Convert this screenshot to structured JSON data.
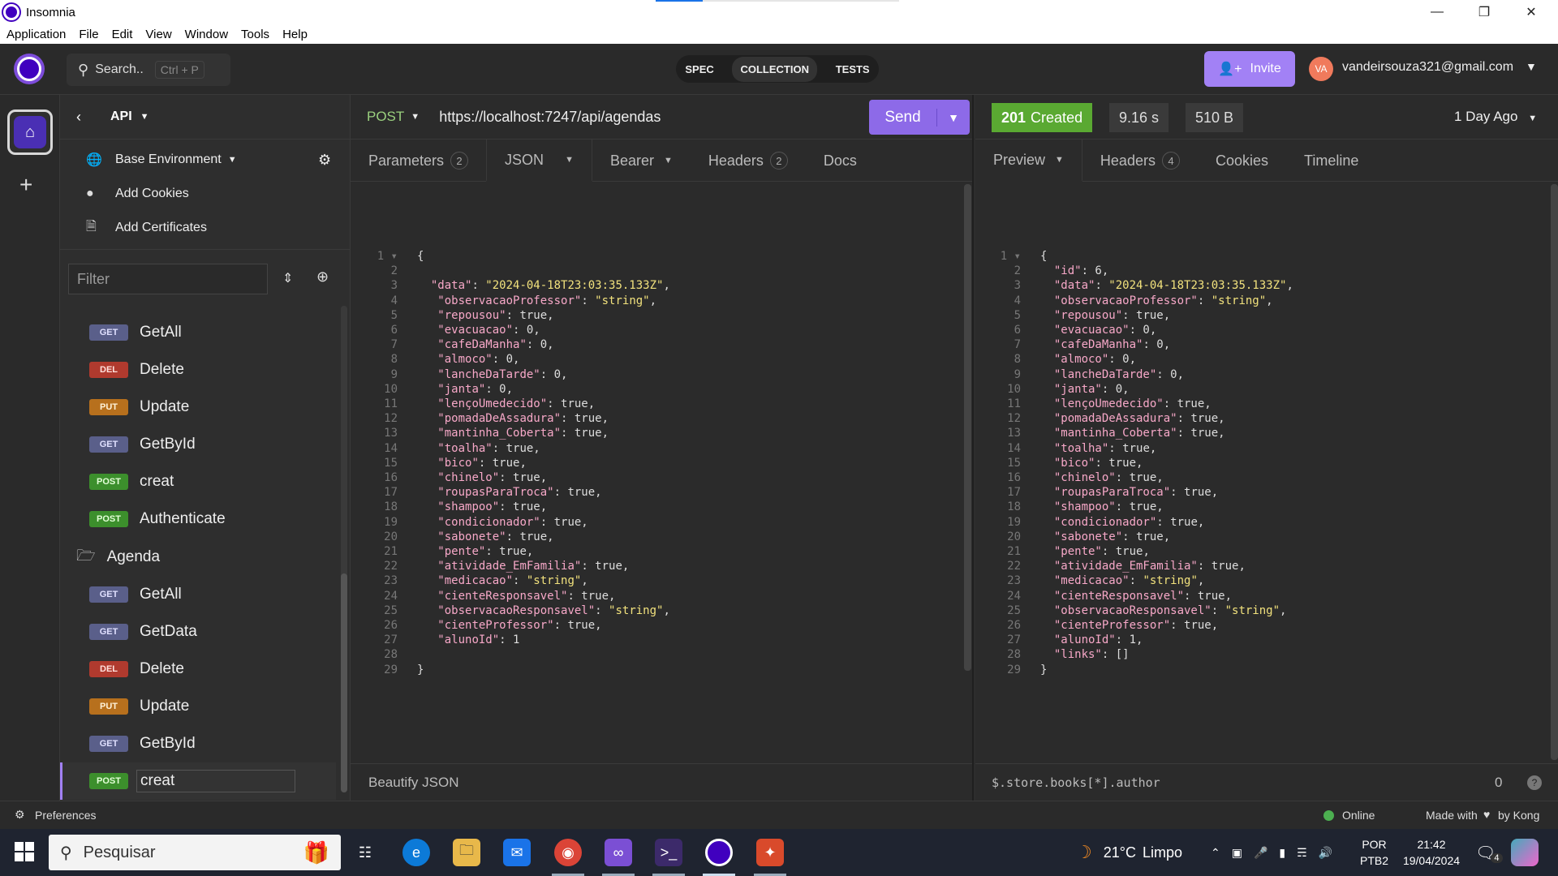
{
  "window": {
    "title": "Insomnia",
    "minimize": "—",
    "maximize": "❐",
    "close": "✕"
  },
  "menu": [
    "Application",
    "File",
    "Edit",
    "View",
    "Window",
    "Tools",
    "Help"
  ],
  "header": {
    "search_label": "Search..",
    "search_shortcut": "Ctrl + P",
    "tabs": [
      "SPEC",
      "COLLECTION",
      "TESTS"
    ],
    "invite_label": "Invite",
    "avatar_initials": "VA",
    "email": "vandeirsouza321@gmail.com"
  },
  "sidebar": {
    "project": "API",
    "environment": "Base Environment",
    "add_cookies": "Add Cookies",
    "add_certificates": "Add Certificates",
    "filter_placeholder": "Filter",
    "requests_top": [
      {
        "method": "GET",
        "name": "GetAll"
      },
      {
        "method": "DEL",
        "name": "Delete"
      },
      {
        "method": "PUT",
        "name": "Update"
      },
      {
        "method": "GET",
        "name": "GetById"
      },
      {
        "method": "POST",
        "name": "creat"
      },
      {
        "method": "POST",
        "name": "Authenticate"
      }
    ],
    "folder": "Agenda",
    "requests_folder": [
      {
        "method": "GET",
        "name": "GetAll"
      },
      {
        "method": "GET",
        "name": "GetData"
      },
      {
        "method": "DEL",
        "name": "Delete"
      },
      {
        "method": "PUT",
        "name": "Update"
      },
      {
        "method": "GET",
        "name": "GetById"
      },
      {
        "method": "POST",
        "name": "creat"
      }
    ]
  },
  "request": {
    "method": "POST",
    "url": "https://localhost:7247/api/agendas",
    "send_label": "Send",
    "tabs": {
      "parameters": "Parameters",
      "parameters_count": "2",
      "json": "JSON",
      "bearer": "Bearer",
      "headers": "Headers",
      "headers_count": "2",
      "docs": "Docs"
    },
    "body_lines": [
      "{",
      "",
      "  \"data\": \"2024-04-18T23:03:35.133Z\",",
      "   \"observacaoProfessor\": \"string\",",
      "   \"repousou\": true,",
      "   \"evacuacao\": 0,",
      "   \"cafeDaManha\": 0,",
      "   \"almoco\": 0,",
      "   \"lancheDaTarde\": 0,",
      "   \"janta\": 0,",
      "   \"lençoUmedecido\": true,",
      "   \"pomadaDeAssadura\": true,",
      "   \"mantinha_Coberta\": true,",
      "   \"toalha\": true,",
      "   \"bico\": true,",
      "   \"chinelo\": true,",
      "   \"roupasParaTroca\": true,",
      "   \"shampoo\": true,",
      "   \"condicionador\": true,",
      "   \"sabonete\": true,",
      "   \"pente\": true,",
      "   \"atividade_EmFamilia\": true,",
      "   \"medicacao\": \"string\",",
      "   \"cienteResponsavel\": true,",
      "   \"observacaoResponsavel\": \"string\",",
      "   \"cienteProfessor\": true,",
      "   \"alunoId\": 1",
      "",
      "}"
    ],
    "footer": "Beautify JSON"
  },
  "response": {
    "status_code": "201",
    "status_text": "Created",
    "time": "9.16 s",
    "size": "510 B",
    "ago": "1 Day Ago",
    "tabs": {
      "preview": "Preview",
      "headers": "Headers",
      "headers_count": "4",
      "cookies": "Cookies",
      "timeline": "Timeline"
    },
    "body_lines": [
      "{",
      "  \"id\": 6,",
      "  \"data\": \"2024-04-18T23:03:35.133Z\",",
      "  \"observacaoProfessor\": \"string\",",
      "  \"repousou\": true,",
      "  \"evacuacao\": 0,",
      "  \"cafeDaManha\": 0,",
      "  \"almoco\": 0,",
      "  \"lancheDaTarde\": 0,",
      "  \"janta\": 0,",
      "  \"lençoUmedecido\": true,",
      "  \"pomadaDeAssadura\": true,",
      "  \"mantinha_Coberta\": true,",
      "  \"toalha\": true,",
      "  \"bico\": true,",
      "  \"chinelo\": true,",
      "  \"roupasParaTroca\": true,",
      "  \"shampoo\": true,",
      "  \"condicionador\": true,",
      "  \"sabonete\": true,",
      "  \"pente\": true,",
      "  \"atividade_EmFamilia\": true,",
      "  \"medicacao\": \"string\",",
      "  \"cienteResponsavel\": true,",
      "  \"observacaoResponsavel\": \"string\",",
      "  \"cienteProfessor\": true,",
      "  \"alunoId\": 1,",
      "  \"links\": []",
      "}"
    ],
    "filter_query": "$.store.books[*].author",
    "filter_count": "0",
    "help": "?"
  },
  "statusbar": {
    "preferences": "Preferences",
    "online": "Online",
    "made_with": "Made with",
    "by_kong": "by Kong"
  },
  "taskbar": {
    "search": "Pesquisar",
    "weather_temp": "21°C",
    "weather_text": "Limpo",
    "lang1": "POR",
    "lang2": "PTB2",
    "time": "21:42",
    "date": "19/04/2024",
    "notif_count": "4"
  },
  "colors": {
    "accent": "#8d6ae8",
    "status_ok": "#5aa932",
    "key": "#f7a8c8",
    "string": "#f2e27d"
  }
}
